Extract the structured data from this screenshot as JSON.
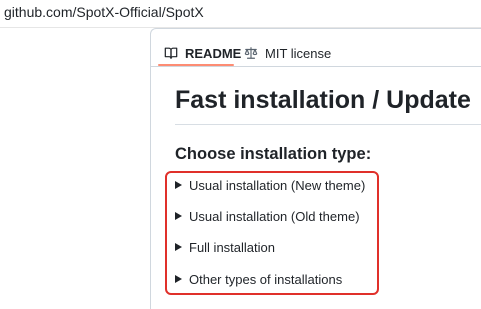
{
  "browser": {
    "url": "github.com/SpotX-Official/SpotX"
  },
  "tabs": [
    {
      "label": "README",
      "icon": "book-icon"
    },
    {
      "label": "MIT license",
      "icon": "scale-icon"
    }
  ],
  "readme": {
    "title": "Fast installation / Update",
    "subheading": "Choose installation type:",
    "options": [
      "Usual installation (New theme)",
      "Usual installation (Old theme)",
      "Full installation",
      "Other types of installations"
    ]
  },
  "colors": {
    "highlight": "#e0302a",
    "active_tab_underline": "#fd8c73"
  }
}
